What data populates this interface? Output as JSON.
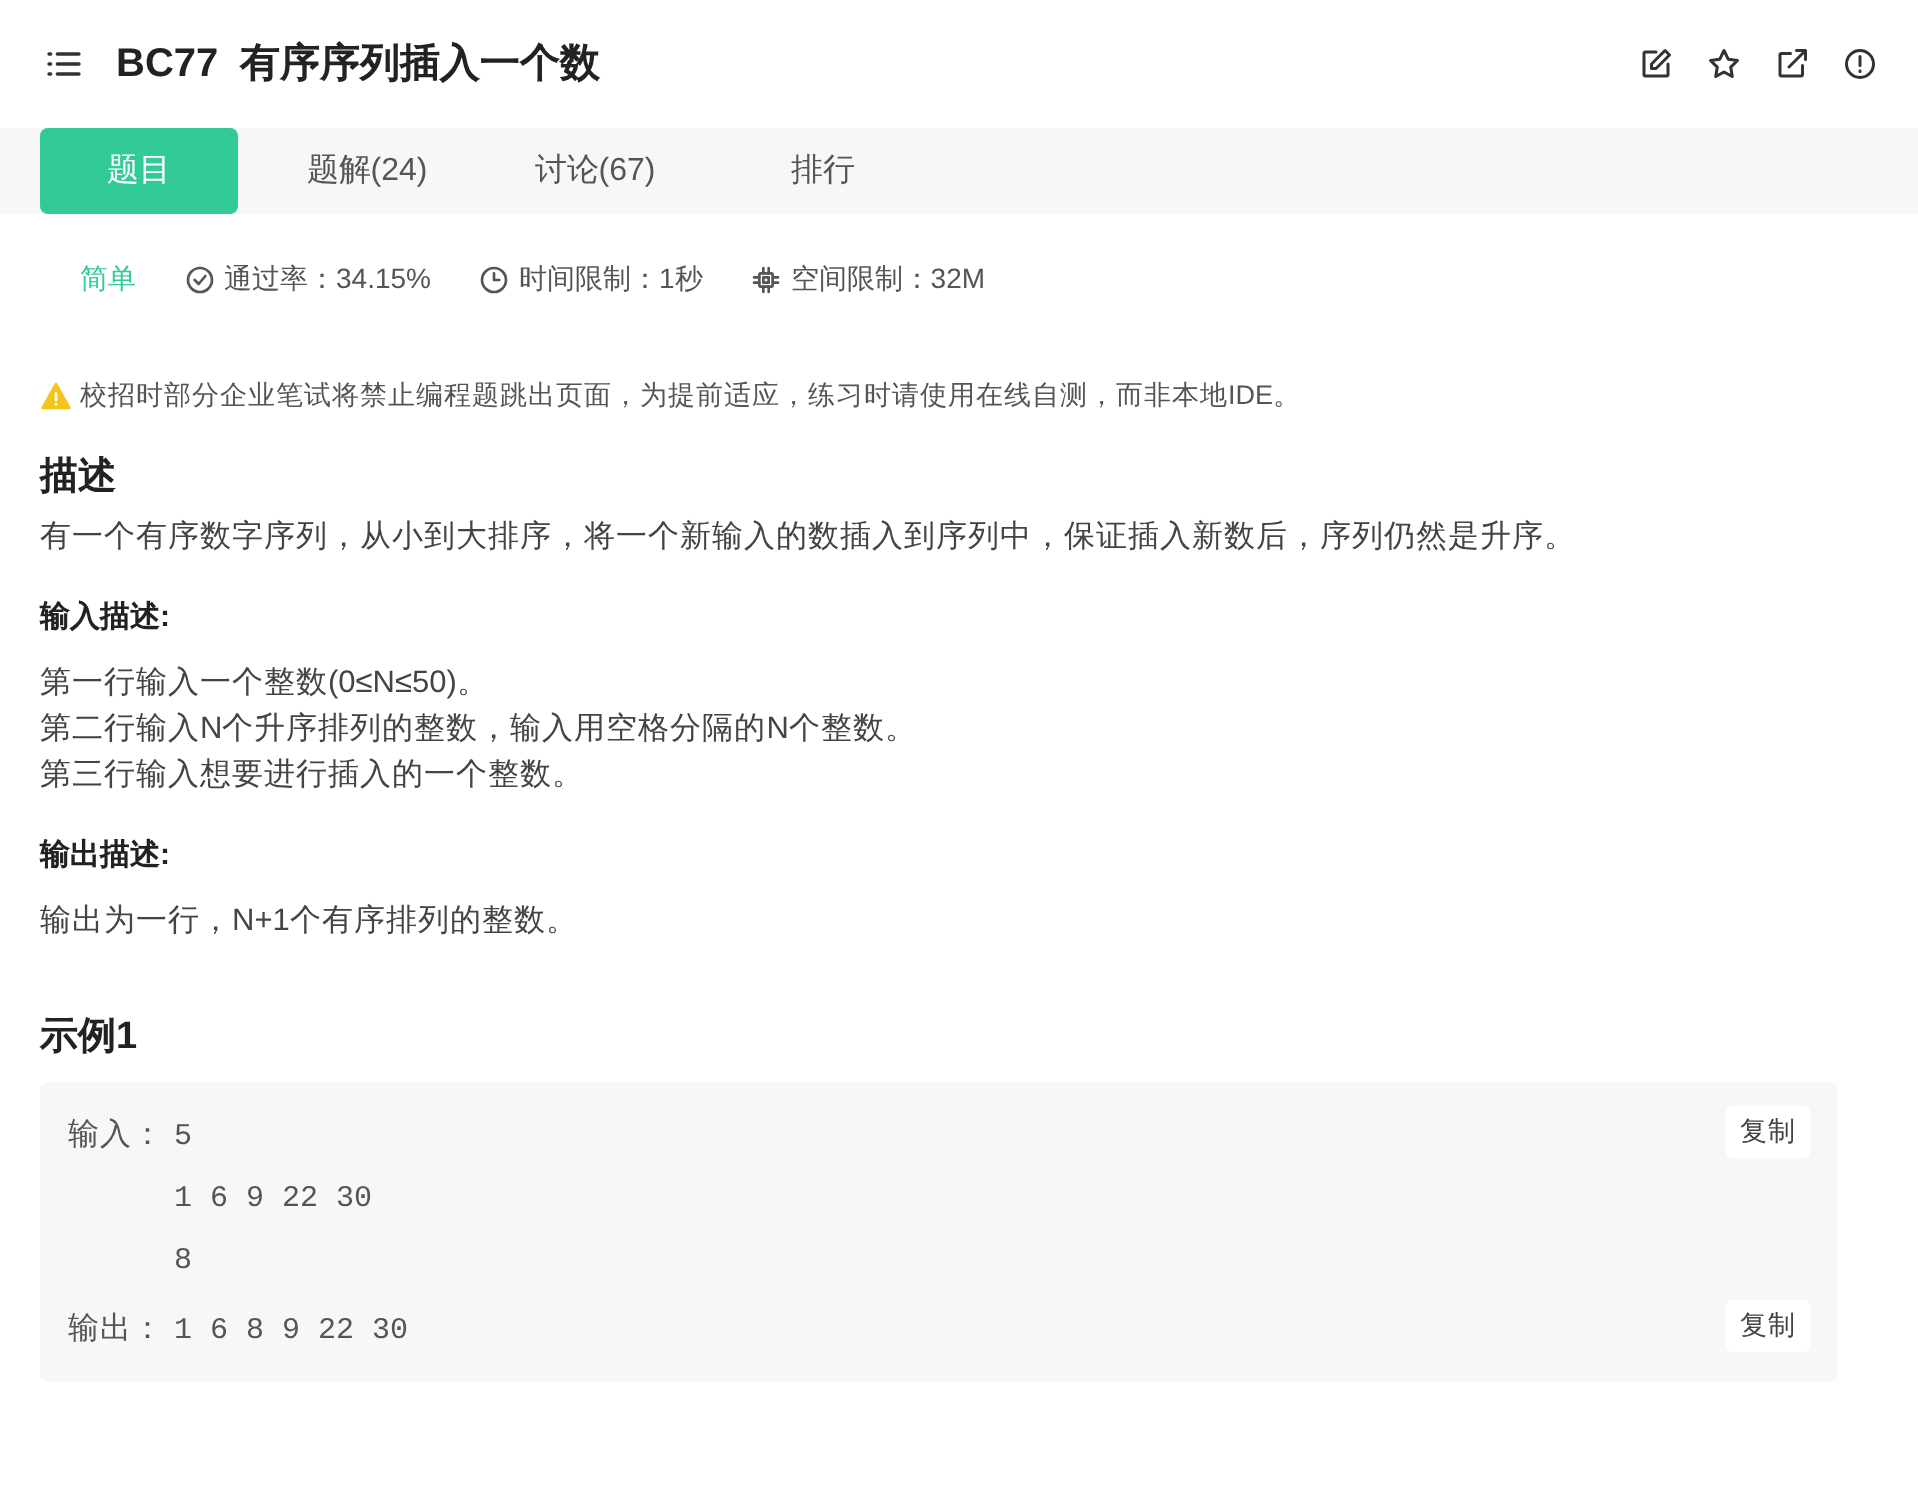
{
  "header": {
    "title": "BC77  有序序列插入一个数"
  },
  "tabs": [
    {
      "label": "题目",
      "selected": true
    },
    {
      "label": "题解(24)",
      "selected": false
    },
    {
      "label": "讨论(67)",
      "selected": false
    },
    {
      "label": "排行",
      "selected": false
    }
  ],
  "meta": {
    "difficulty": "简单",
    "pass_rate": "通过率：34.15%",
    "time_limit": "时间限制：1秒",
    "memory_limit": "空间限制：32M"
  },
  "notice": "校招时部分企业笔试将禁止编程题跳出页面，为提前适应，练习时请使用在线自测，而非本地IDE。",
  "sections": [
    {
      "title": "描述",
      "kind": "main",
      "lines": [
        "有一个有序数字序列，从小到大排序，将一个新输入的数插入到序列中，保证插入新数后，序列仍然是升序。"
      ]
    },
    {
      "title": "输入描述:",
      "kind": "sub",
      "lines": [
        "第一行输入一个整数(0≤N≤50)。",
        "第二行输入N个升序排列的整数，输入用空格分隔的N个整数。",
        "第三行输入想要进行插入的一个整数。"
      ]
    },
    {
      "title": "输出描述:",
      "kind": "sub",
      "lines": [
        "输出为一行，N+1个有序排列的整数。"
      ]
    }
  ],
  "example": {
    "title": "示例1",
    "blocks": [
      {
        "label": "输入：",
        "lines": [
          "5",
          "1 6 9 22 30",
          "8"
        ],
        "copy": "复制"
      },
      {
        "label": "输出：",
        "lines": [
          "1 6 8 9 22 30"
        ],
        "copy": "复制"
      }
    ]
  }
}
